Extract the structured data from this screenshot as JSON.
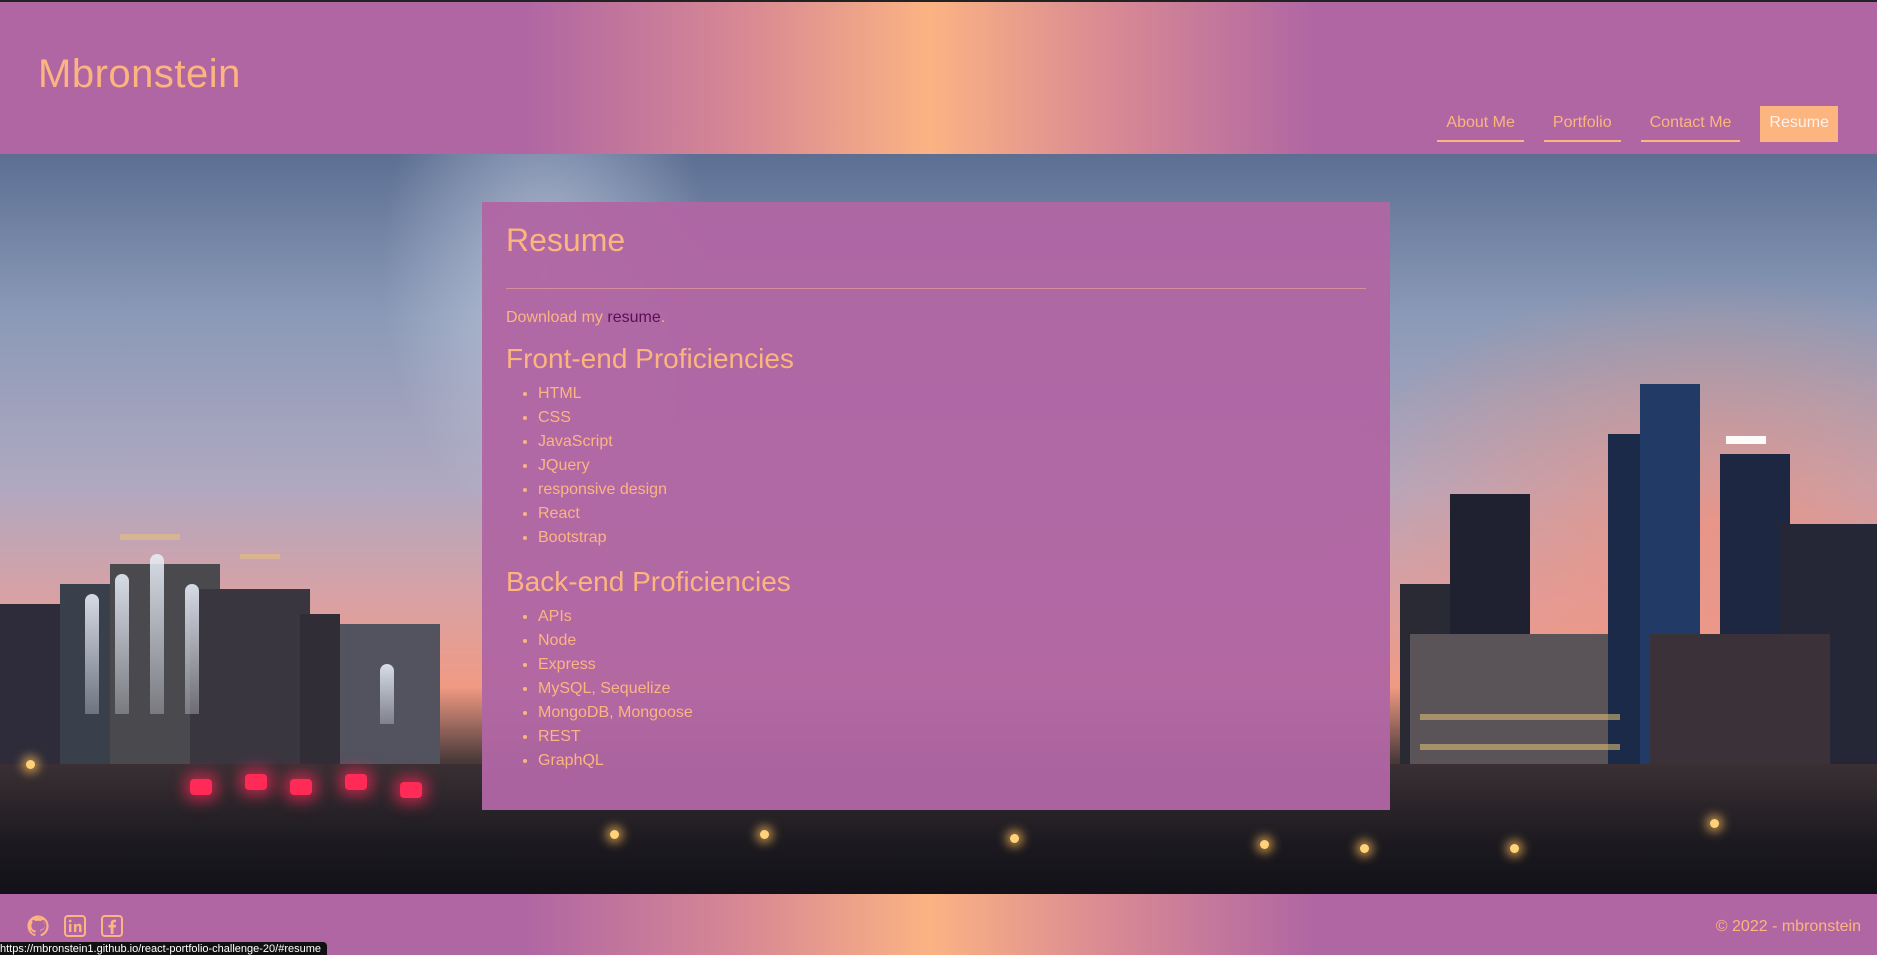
{
  "header": {
    "brand": "Mbronstein",
    "nav": [
      {
        "label": "About Me"
      },
      {
        "label": "Portfolio"
      },
      {
        "label": "Contact Me"
      },
      {
        "label": "Resume",
        "active": true
      }
    ]
  },
  "main": {
    "title": "Resume",
    "download_prefix": "Download my ",
    "download_link": "resume",
    "download_suffix": ".",
    "frontend": {
      "heading": "Front-end Proficiencies",
      "items": [
        "HTML",
        "CSS",
        "JavaScript",
        "JQuery",
        "responsive design",
        "React",
        "Bootstrap"
      ]
    },
    "backend": {
      "heading": "Back-end Proficiencies",
      "items": [
        "APIs",
        "Node",
        "Express",
        "MySQL, Sequelize",
        "MongoDB, Mongoose",
        "REST",
        "GraphQL"
      ]
    }
  },
  "footer": {
    "icons": [
      "github-icon",
      "linkedin-icon",
      "facebook-icon"
    ],
    "copyright": "© 2022 - mbronstein"
  },
  "status_bar": {
    "url": "https://mbronstein1.github.io/react-portfolio-challenge-20/#resume"
  },
  "colors": {
    "primary": "#b066a3",
    "accent": "#fcb57f",
    "link": "#5c0f57"
  }
}
